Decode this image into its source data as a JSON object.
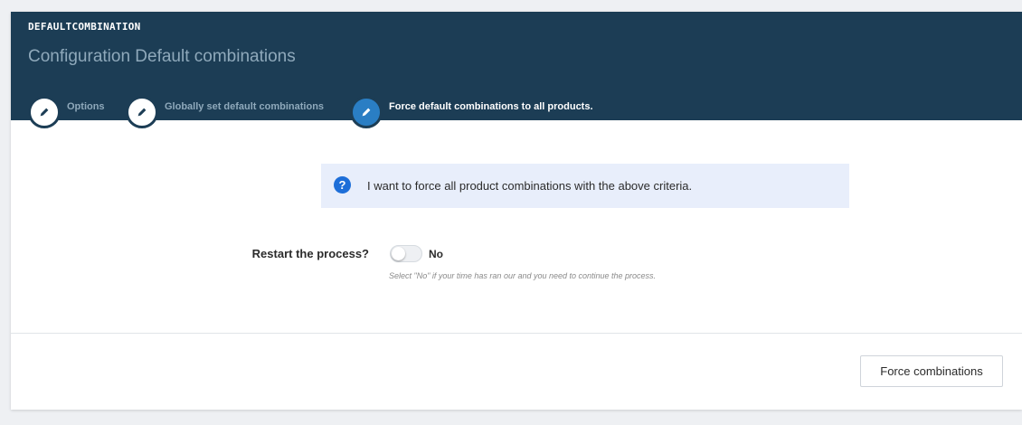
{
  "header": {
    "module_name": "DEFAULTCOMBINATION",
    "title": "Configuration Default combinations"
  },
  "tabs": [
    {
      "label": "Options",
      "icon": "pencil-icon",
      "active": false
    },
    {
      "label": "Globally set default combinations",
      "icon": "pencil-icon",
      "active": false
    },
    {
      "label": "Force default combinations to all products.",
      "icon": "pencil-icon",
      "active": true
    }
  ],
  "info": {
    "icon": "question-icon",
    "icon_glyph": "?",
    "text": "I want to force all product combinations with the above criteria."
  },
  "restart_field": {
    "label": "Restart the process?",
    "value": "No",
    "enabled": false,
    "help": "Select \"No\" if your time has ran our and you need to continue the process."
  },
  "footer": {
    "submit_label": "Force combinations"
  },
  "colors": {
    "header_bg": "#1c3d55",
    "active_tab": "#2a7ec4",
    "info_bg": "#e8eefb",
    "info_icon": "#1d6ed8"
  }
}
